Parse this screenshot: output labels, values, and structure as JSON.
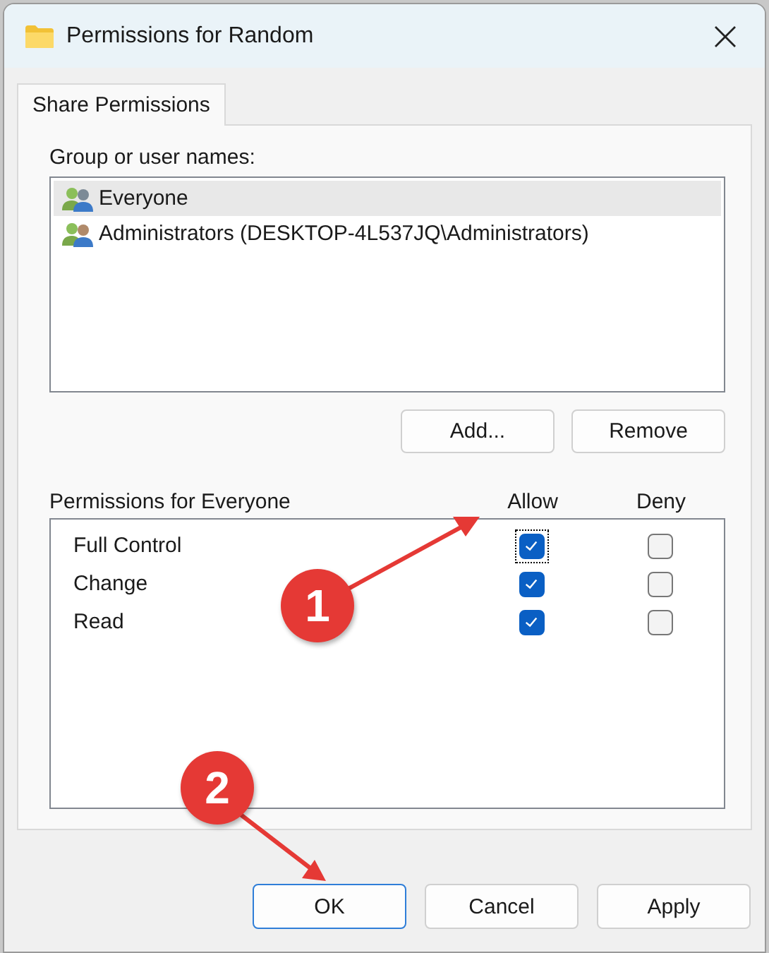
{
  "window": {
    "title": "Permissions for Random"
  },
  "tabs": [
    {
      "label": "Share Permissions",
      "selected": true
    }
  ],
  "group_label": "Group or user names:",
  "users": [
    {
      "name": "Everyone",
      "selected": true
    },
    {
      "name": "Administrators (DESKTOP-4L537JQ\\Administrators)",
      "selected": false
    }
  ],
  "user_buttons": [
    "Add...",
    "Remove"
  ],
  "permissions": {
    "title": "Permissions for Everyone",
    "allow_label": "Allow",
    "deny_label": "Deny",
    "rows": [
      {
        "name": "Full Control",
        "allow": true,
        "deny": false,
        "focused": true
      },
      {
        "name": "Change",
        "allow": true,
        "deny": false,
        "focused": false
      },
      {
        "name": "Read",
        "allow": true,
        "deny": false,
        "focused": false
      }
    ]
  },
  "buttons": [
    {
      "label": "OK",
      "default": true
    },
    {
      "label": "Cancel",
      "default": false
    },
    {
      "label": "Apply",
      "default": false
    }
  ],
  "annotations": [
    {
      "number": "1"
    },
    {
      "number": "2"
    }
  ]
}
